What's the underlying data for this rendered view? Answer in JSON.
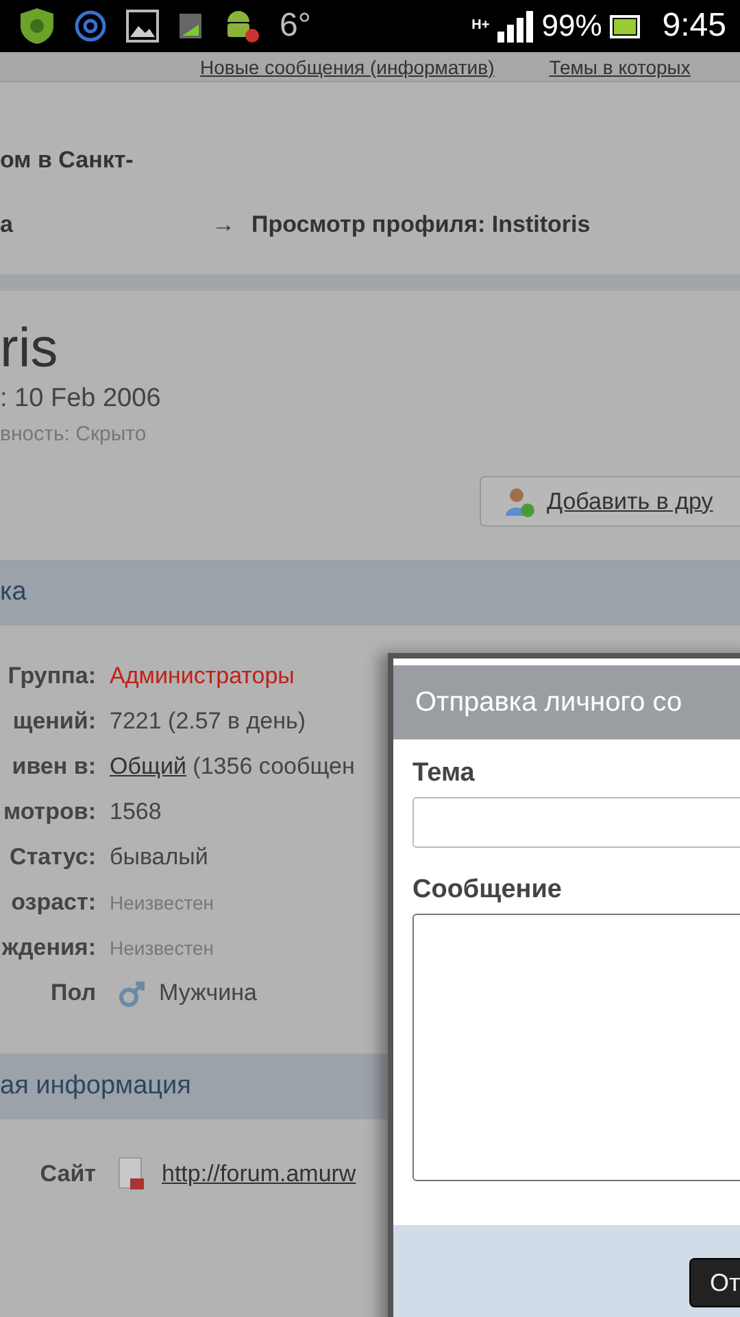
{
  "status_bar": {
    "temperature": "6°",
    "network": "H+",
    "battery": "99%",
    "time": "9:45"
  },
  "top_links": [
    "Новые сообщения (информатив)",
    "Темы в которых"
  ],
  "breadcrumb": {
    "line_1": "ом в Санкт-",
    "line_2": "а",
    "arrow": "→",
    "current": "Просмотр профиля: Institoris"
  },
  "profile": {
    "name": "ris",
    "joined": ": 10 Feb 2006",
    "visibility": "вность: Скрыто",
    "add_friend": "Добавить в дру"
  },
  "sections": [
    {
      "title": "ка",
      "rows": [
        {
          "kind": "accent",
          "label": "Группа:",
          "value": "Администраторы"
        },
        {
          "kind": "text",
          "label": "щений:",
          "value": "7221 (2.57 в день)"
        },
        {
          "kind": "link",
          "label": "ивен в:",
          "link": "Общий",
          "value": " (1356 сообщен"
        },
        {
          "kind": "text",
          "label": "мотров:",
          "value": "1568"
        },
        {
          "kind": "text",
          "label": "Статус:",
          "value": "бывалый"
        },
        {
          "kind": "muted",
          "label": "озраст:",
          "value": "Неизвестен"
        },
        {
          "kind": "muted",
          "label": "ждения:",
          "value": "Неизвестен"
        },
        {
          "kind": "gender",
          "label": "Пол",
          "value": "Мужчина"
        }
      ]
    },
    {
      "title": "ая информация",
      "rows": [
        {
          "kind": "site",
          "label": "Сайт",
          "link": "http://forum.amurw"
        }
      ]
    }
  ],
  "dialog": {
    "title": "Отправка личного со",
    "subject_label": "Тема",
    "message_label": "Сообщение",
    "send_button": "От"
  }
}
